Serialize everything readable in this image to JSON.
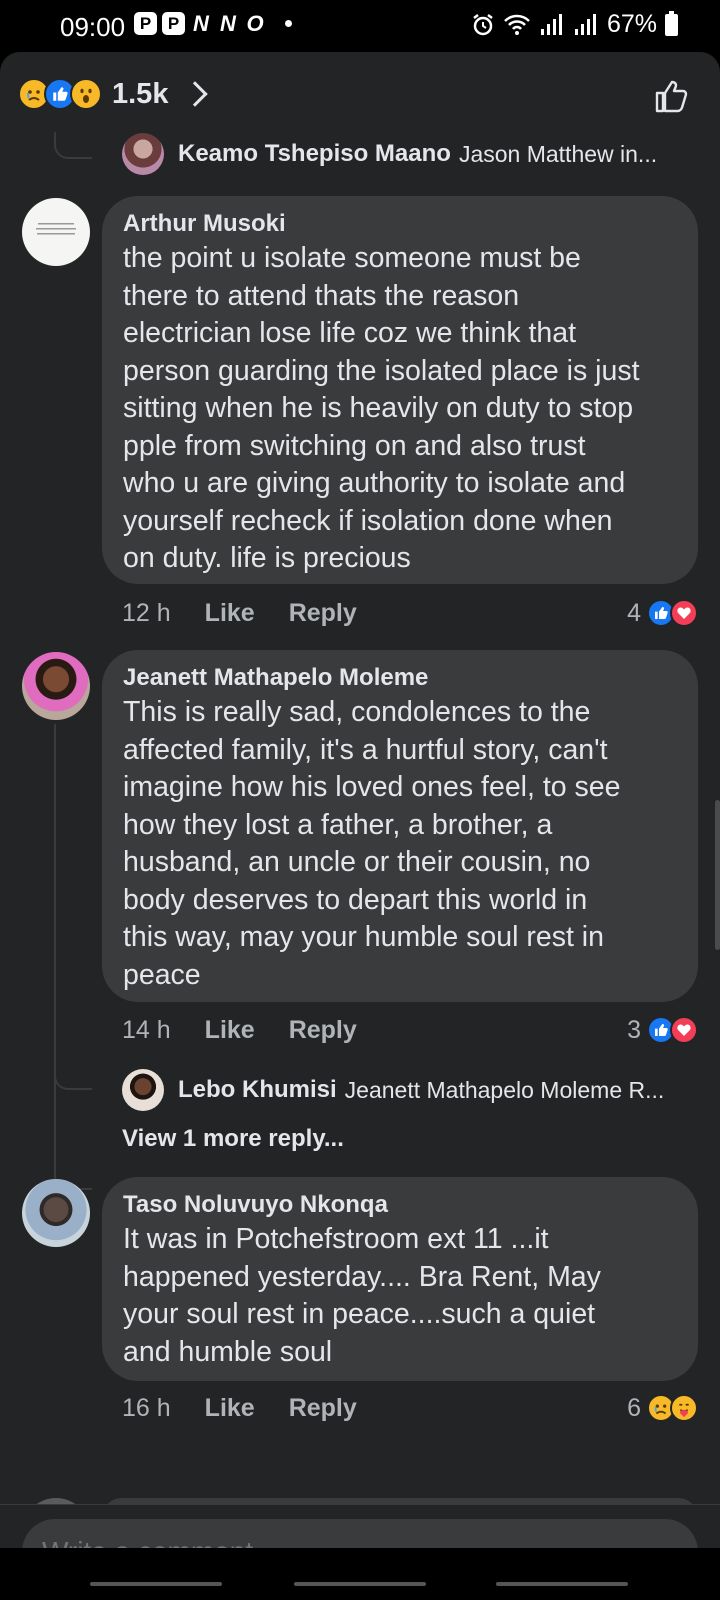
{
  "status_bar": {
    "time": "09:00",
    "app_icons": [
      "P",
      "P",
      "N",
      "N",
      "O"
    ],
    "battery": "67%"
  },
  "header": {
    "reaction_count": "1.5k",
    "reaction_icons": [
      "sad-emoji-icon",
      "like-emoji-icon",
      "wow-emoji-icon"
    ]
  },
  "thread": {
    "reply_preview_1": {
      "name": "Keamo Tshepiso Maano",
      "text": "Jason Matthew in..."
    },
    "comments": [
      {
        "name": "Arthur Musoki",
        "lines": [
          "the point u isolate  someone must be",
          "there to attend thats the reason",
          "electrician lose life coz we think that",
          "person guarding the isolated place is just",
          "sitting when he is heavily on duty to stop",
          "pple from switching on and also  trust",
          "who u are  giving authority to isolate  and",
          "yourself recheck if isolation done when",
          "on duty. life is precious"
        ],
        "time": "12 h",
        "like_label": "Like",
        "reply_label": "Reply",
        "reaction_count": "4"
      },
      {
        "name": "Jeanett Mathapelo Moleme",
        "lines": [
          "This is really sad, condolences to the",
          "affected family, it's a hurtful story, can't",
          "imagine how his loved ones feel, to see",
          "how they lost a father, a brother, a",
          "husband, an uncle or their cousin, no",
          "body deserves to depart this world in",
          "this way, may your humble soul rest in",
          "peace"
        ],
        "time": "14 h",
        "like_label": "Like",
        "reply_label": "Reply",
        "reaction_count": "3"
      },
      {
        "name": "Taso Noluvuyo Nkonqa",
        "lines": [
          "It was in Potchefstroom ext 11 ...it",
          "happened yesterday.... Bra Rent, May",
          "your soul rest in peace....such a quiet",
          "and humble soul"
        ],
        "time": "16 h",
        "like_label": "Like",
        "reply_label": "Reply",
        "reaction_count": "6"
      }
    ],
    "reply_preview_2": {
      "name": "Lebo Khumisi",
      "text": "Jeanett Mathapelo Moleme R..."
    },
    "view_more": "View 1 more reply..."
  },
  "composer": {
    "placeholder": "Write a comment..."
  },
  "colors": {
    "background": "#232425",
    "bubble": "#3a3b3c",
    "like_blue": "#1877f2",
    "love_red": "#f33e58",
    "emoji_yellow": "#f7b928"
  }
}
